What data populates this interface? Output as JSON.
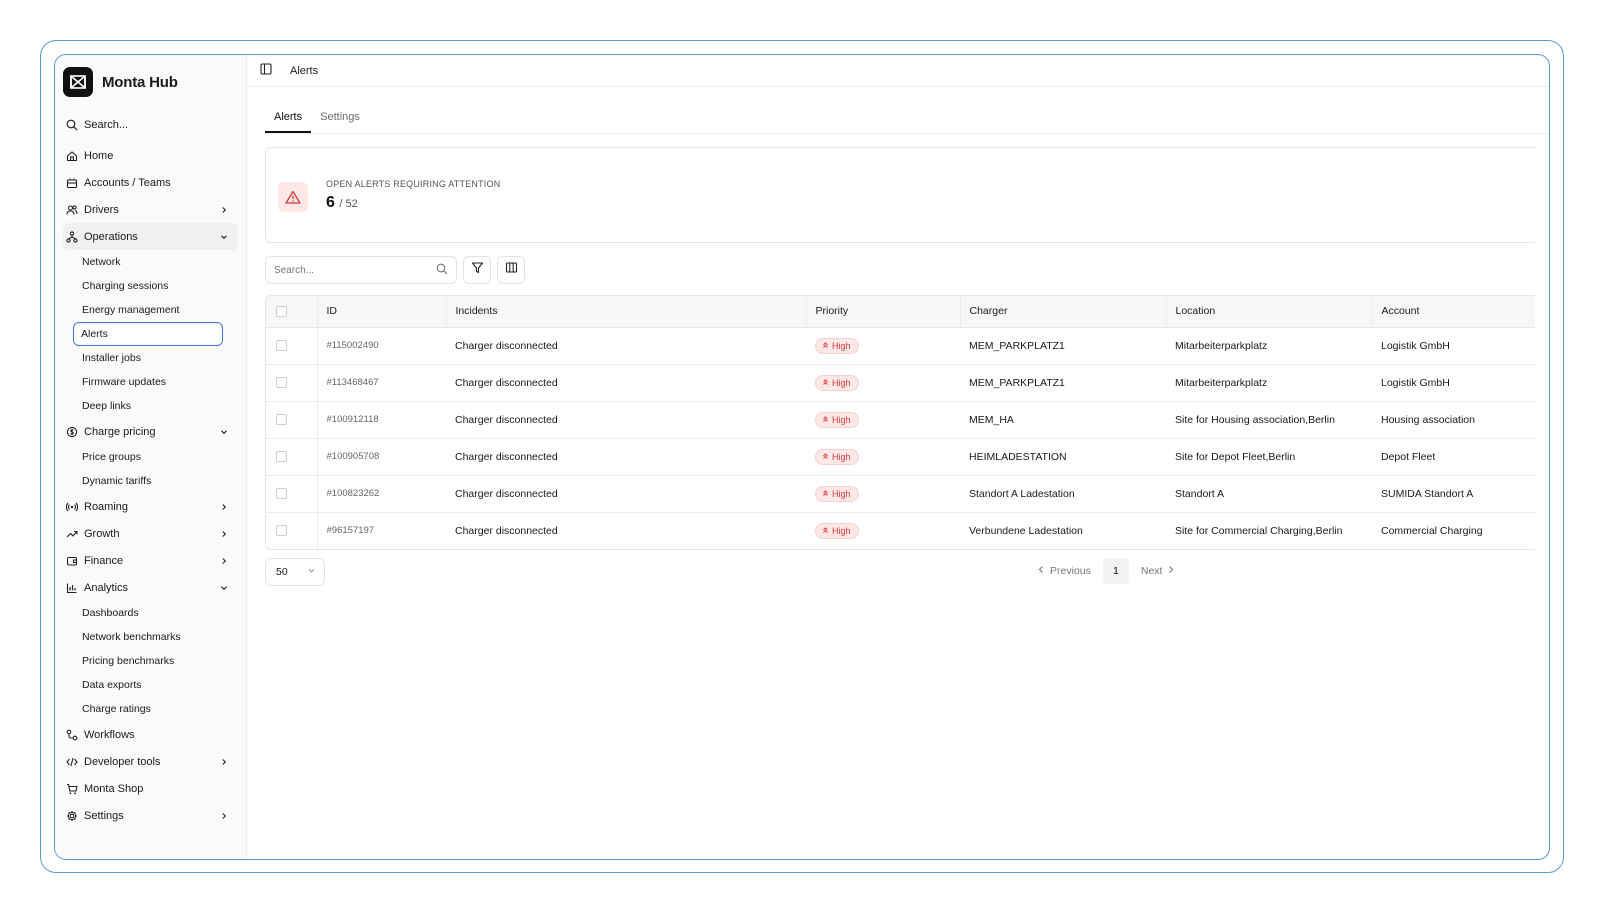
{
  "app": {
    "name": "Monta Hub"
  },
  "sidebar": {
    "search_label": "Search...",
    "items": [
      {
        "label": "Home",
        "icon": "home-icon"
      },
      {
        "label": "Accounts / Teams",
        "icon": "building-icon"
      },
      {
        "label": "Drivers",
        "icon": "users-icon",
        "chevron": "right"
      },
      {
        "label": "Operations",
        "icon": "network-icon",
        "chevron": "down",
        "children": [
          "Network",
          "Charging sessions",
          "Energy management",
          "Alerts",
          "Installer jobs",
          "Firmware updates",
          "Deep links"
        ]
      },
      {
        "label": "Charge pricing",
        "icon": "coin-icon",
        "chevron": "down",
        "children": [
          "Price groups",
          "Dynamic tariffs"
        ]
      },
      {
        "label": "Roaming",
        "icon": "signal-icon",
        "chevron": "right"
      },
      {
        "label": "Growth",
        "icon": "trend-icon",
        "chevron": "right"
      },
      {
        "label": "Finance",
        "icon": "wallet-icon",
        "chevron": "right"
      },
      {
        "label": "Analytics",
        "icon": "chart-icon",
        "chevron": "down",
        "children": [
          "Dashboards",
          "Network benchmarks",
          "Pricing benchmarks",
          "Data exports",
          "Charge ratings"
        ]
      },
      {
        "label": "Workflows",
        "icon": "workflow-icon"
      },
      {
        "label": "Developer tools",
        "icon": "code-icon",
        "chevron": "right"
      },
      {
        "label": "Monta Shop",
        "icon": "cart-icon"
      },
      {
        "label": "Settings",
        "icon": "gear-icon",
        "chevron": "right"
      }
    ],
    "active_sub": "Alerts"
  },
  "header": {
    "title": "Alerts"
  },
  "tabs": [
    {
      "label": "Alerts",
      "active": true
    },
    {
      "label": "Settings",
      "active": false
    }
  ],
  "summary": {
    "label": "OPEN ALERTS REQUIRING ATTENTION",
    "count": "6",
    "total": "/ 52"
  },
  "toolbar": {
    "search_placeholder": "Search..."
  },
  "table": {
    "columns": [
      "ID",
      "Incidents",
      "Priority",
      "Charger",
      "Location",
      "Account"
    ],
    "rows": [
      {
        "id": "#115002490",
        "incident": "Charger disconnected",
        "priority": "High",
        "charger": "MEM_PARKPLATZ1",
        "location": "Mitarbeiterparkplatz",
        "account": "Logistik GmbH"
      },
      {
        "id": "#113468467",
        "incident": "Charger disconnected",
        "priority": "High",
        "charger": "MEM_PARKPLATZ1",
        "location": "Mitarbeiterparkplatz",
        "account": "Logistik GmbH"
      },
      {
        "id": "#100912118",
        "incident": "Charger disconnected",
        "priority": "High",
        "charger": "MEM_HA",
        "location": "Site for Housing association,Berlin",
        "account": "Housing association"
      },
      {
        "id": "#100905708",
        "incident": "Charger disconnected",
        "priority": "High",
        "charger": "HEIMLADESTATION",
        "location": "Site for Depot Fleet,Berlin",
        "account": "Depot Fleet"
      },
      {
        "id": "#100823262",
        "incident": "Charger disconnected",
        "priority": "High",
        "charger": "Standort A Ladestation",
        "location": "Standort A",
        "account": "SUMIDA Standort A"
      },
      {
        "id": "#96157197",
        "incident": "Charger disconnected",
        "priority": "High",
        "charger": "Verbundene Ladestation",
        "location": "Site for Commercial Charging,Berlin",
        "account": "Commercial Charging"
      }
    ]
  },
  "pagination": {
    "page_size": "50",
    "previous": "Previous",
    "current": "1",
    "next": "Next"
  },
  "colors": {
    "accent": "#3a7bd5",
    "danger": "#d63a3a",
    "danger_bg": "#fde8e8"
  }
}
